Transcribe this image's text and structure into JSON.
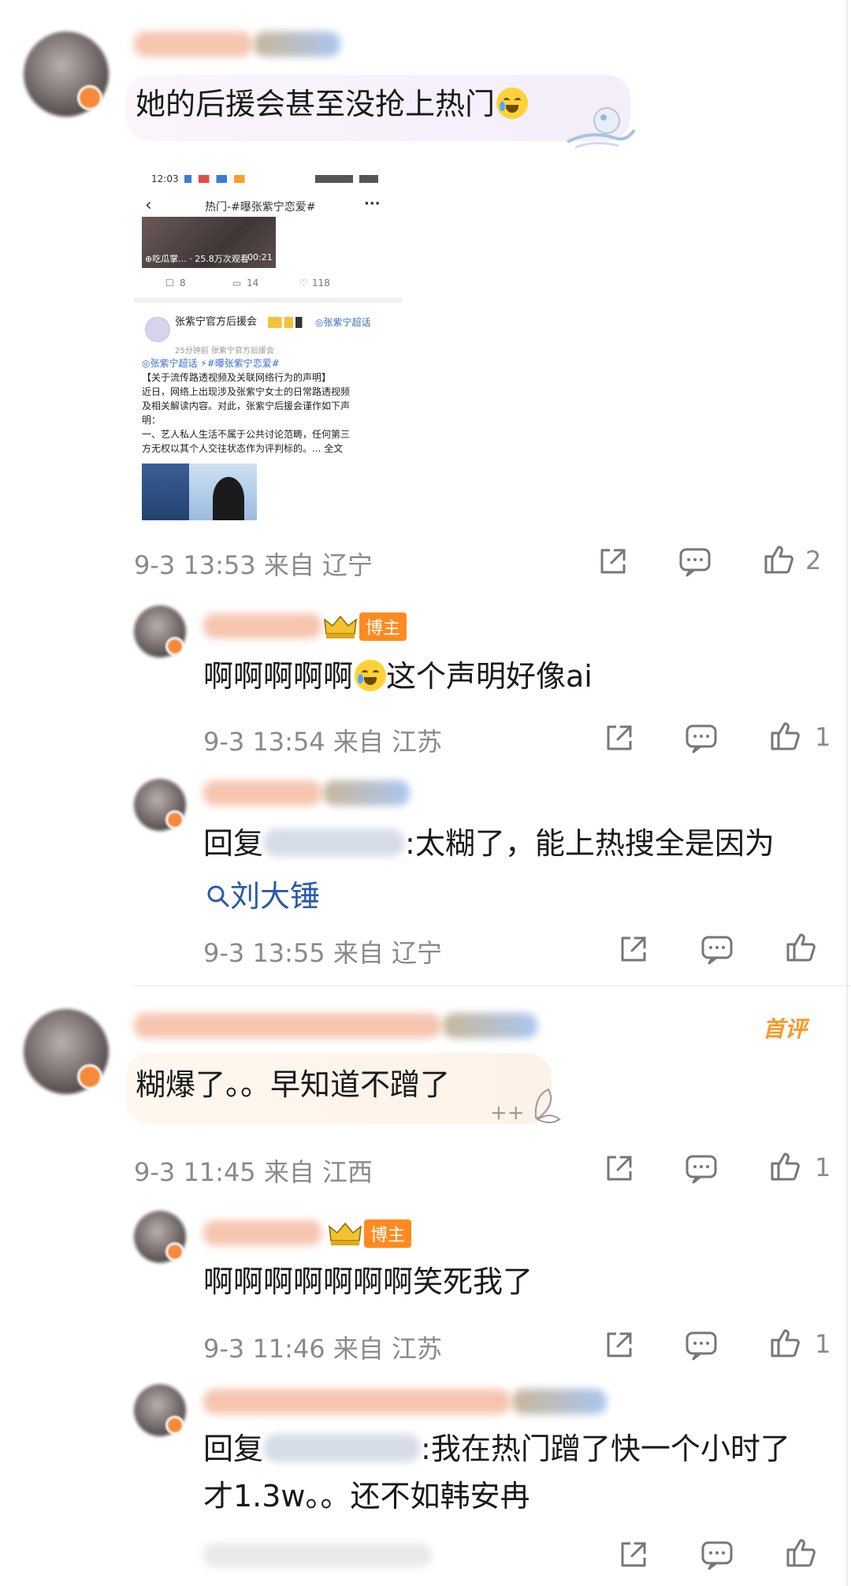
{
  "comments": [
    {
      "text": "她的后援会甚至没抢上热门",
      "meta": "9-3 13:53  来自 辽宁",
      "likes": "2",
      "embedded_screenshot": {
        "status_time": "12:03",
        "title": "热门-#曝张紫宁恋爱#",
        "more": "···",
        "video_caption": "⊕吃瓜掌... · 25.8万次观看",
        "video_duration": "00:21",
        "repost_count": "8",
        "comment_count": "14",
        "like_count": "118",
        "author": "张紫宁官方后援会",
        "author_tag": "◎张紫宁超话",
        "time_source": "25分钟前  张紫宁官方后援会",
        "tags_line": "◎张紫宁超话 ⚡#曝张紫宁恋爱#",
        "post_lines": [
          "【关于流传路透视频及关联网络行为的声明】",
          "近日，网络上出现涉及张紫宁女士的日常路透视频",
          "及相关解读内容。对此，张紫宁后援会谨作如下声",
          "明：",
          "一、艺人私人生活不属于公共讨论范畴，任何第三",
          "方无权以其个人交往状态作为评判标的。... 全文"
        ]
      },
      "replies": [
        {
          "badge": "博主",
          "text": "啊啊啊啊啊",
          "text_after": "这个声明好像ai",
          "meta": "9-3 13:54  来自 江苏",
          "likes": "1"
        },
        {
          "reply_prefix": "回复",
          "text": ":太糊了，能上热搜全是因为",
          "search_link": "刘大锤",
          "meta": "9-3 13:55  来自 辽宁",
          "likes": ""
        }
      ]
    },
    {
      "first_comment_label": "首评",
      "text": "糊爆了。。早知道不蹭了",
      "meta": "9-3 11:45  来自 江西",
      "likes": "1",
      "replies": [
        {
          "badge": "博主",
          "text": "啊啊啊啊啊啊啊笑死我了",
          "meta": "9-3 11:46  来自 江苏",
          "likes": "1"
        },
        {
          "reply_prefix": "回复",
          "text": ":我在热门蹭了快一个小时了",
          "text_line2": "才1.3w。。还不如韩安冉",
          "likes": ""
        }
      ]
    }
  ],
  "icons": [
    "share-icon",
    "comment-icon",
    "like-icon",
    "crown-icon",
    "search-icon"
  ],
  "colors": {
    "accent_orange": "#ff8a1f",
    "link_blue": "#2a5aa8",
    "meta_gray": "#8a8a8a"
  }
}
